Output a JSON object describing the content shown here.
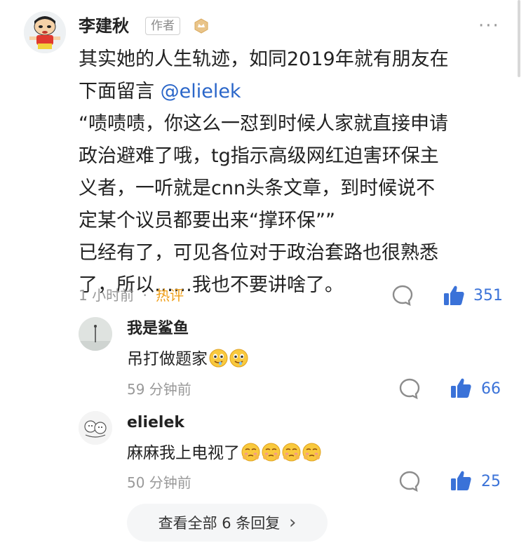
{
  "main_comment": {
    "author": "李建秋",
    "author_tag": "作者",
    "text_parts": {
      "line1": "其实她的人生轨迹，如同2019年就有朋友在",
      "line2_prefix": "下面留言 ",
      "mention": "@elielek",
      "rest": "“啧啧啧，你这么一怼到时候人家就直接申请\n政治避难了哦，tg指示高级网红迫害环保主\n义者，一听就是cnn头条文章，到时候说不\n定某个议员都要出来“撑环保””\n已经有了，可见各位对于政治套路也很熟悉\n了，所以……我也不要讲啥了。"
    },
    "time": "1 小时前",
    "separator": "·",
    "hot_label": "热评",
    "like_count": "351"
  },
  "replies": [
    {
      "name": "我是鲨鱼",
      "text": "吊打做题家",
      "emoji": "drooling-face",
      "emoji_count": 2,
      "time": "59 分钟前",
      "like_count": "66"
    },
    {
      "name": "elielek",
      "text": "麻麻我上电视了",
      "emoji": "pleading-face",
      "emoji_count": 4,
      "time": "50 分钟前",
      "like_count": "25"
    }
  ],
  "view_all": {
    "label": "查看全部 6 条回复",
    "chevron": "›"
  },
  "more_menu": "···",
  "colors": {
    "accent": "#3a72d8",
    "hot": "#f0a01a",
    "mention": "#2a66c9"
  }
}
